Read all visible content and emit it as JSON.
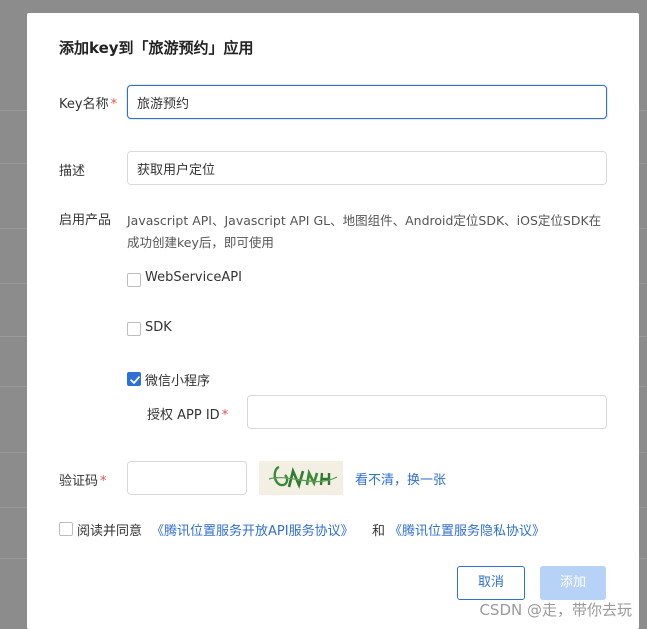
{
  "dialog": {
    "title": "添加key到「旅游预约」应用"
  },
  "form": {
    "key_name": {
      "label": "Key名称",
      "required_mark": "*",
      "value": "旅游预约"
    },
    "description": {
      "label": "描述",
      "value": "获取用户定位"
    },
    "products": {
      "label": "启用产品",
      "note": "Javascript API、Javascript API GL、地图组件、Android定位SDK、iOS定位SDK在成功创建key后，即可使用",
      "options": [
        {
          "label": "WebServiceAPI",
          "checked": false
        },
        {
          "label": "SDK",
          "checked": false
        },
        {
          "label": "微信小程序",
          "checked": true
        }
      ],
      "app_id": {
        "label": "授权 APP ID",
        "required_mark": "*",
        "value": ""
      }
    },
    "captcha": {
      "label": "验证码",
      "required_mark": "*",
      "value": "",
      "refresh_link": "看不清，换一张"
    },
    "agreement": {
      "checked": false,
      "prefix": "阅读并同意",
      "link1": "《腾讯位置服务开放API服务协议》",
      "conjunction": "和",
      "link2": "《腾讯位置服务隐私协议》"
    }
  },
  "buttons": {
    "cancel": "取消",
    "add": "添加"
  },
  "watermark": "CSDN @走，带你去玩",
  "colors": {
    "primary": "#2f6fd8",
    "required": "#e84d4d",
    "disabled_button": "#b7d2f7",
    "overlay": "#8c8c8c"
  }
}
